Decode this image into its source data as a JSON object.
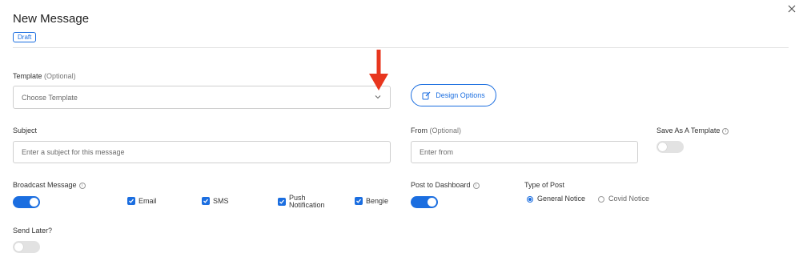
{
  "header": {
    "title": "New Message",
    "status_badge": "Draft",
    "close_icon": "close-icon"
  },
  "template": {
    "label": "Template",
    "optional": "(Optional)",
    "placeholder": "Choose Template",
    "design_button": "Design Options",
    "annotation_arrow_color": "#e8361e"
  },
  "subject": {
    "label": "Subject",
    "placeholder": "Enter a subject for this message"
  },
  "from": {
    "label": "From",
    "optional": "(Optional)",
    "placeholder": "Enter from"
  },
  "save_template": {
    "label": "Save As A Template",
    "enabled": false
  },
  "broadcast": {
    "label": "Broadcast Message",
    "enabled": true,
    "channels": [
      {
        "label": "Email",
        "checked": true
      },
      {
        "label": "SMS",
        "checked": true
      },
      {
        "label_line1": "Push",
        "label_line2": "Notification",
        "checked": true
      },
      {
        "label": "Bengie",
        "checked": true
      }
    ]
  },
  "dashboard": {
    "label": "Post to Dashboard",
    "enabled": true
  },
  "type_of_post": {
    "label": "Type of Post",
    "options": [
      {
        "label": "General Notice",
        "selected": true
      },
      {
        "label": "Covid Notice",
        "selected": false
      }
    ]
  },
  "send_later": {
    "label": "Send Later?",
    "enabled": false
  },
  "colors": {
    "accent": "#1b6ee0",
    "toggle_off": "#e2e2e2"
  }
}
